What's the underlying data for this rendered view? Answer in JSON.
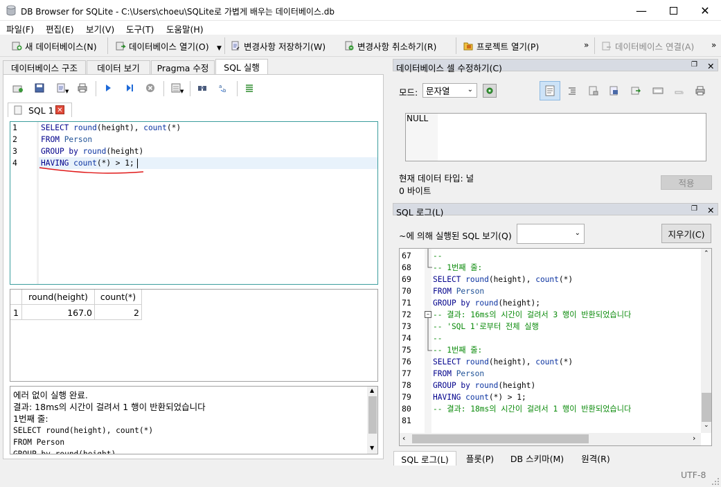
{
  "window": {
    "title": "DB Browser for SQLite - C:\\Users\\choeu\\SQLite로 가볍게 배우는 데이터베이스.db"
  },
  "menu": [
    "파일(F)",
    "편집(E)",
    "보기(V)",
    "도구(T)",
    "도움말(H)"
  ],
  "toolbar": {
    "new_db": "새 데이터베이스(N)",
    "open_db": "데이터베이스 열기(O)",
    "write_changes": "변경사항 저장하기(W)",
    "revert_changes": "변경사항 취소하기(R)",
    "open_project": "프로젝트 열기(P)",
    "attach_db": "데이터베이스 연결(A)"
  },
  "tabs": [
    "데이터베이스 구조",
    "데이터 보기",
    "Pragma 수정",
    "SQL 실행"
  ],
  "sql_tab": {
    "name": "SQL 1"
  },
  "editor": {
    "lines": [
      {
        "n": "1",
        "tokens": [
          [
            "kw",
            "SELECT "
          ],
          [
            "fn",
            "round"
          ],
          [
            "",
            "(height), "
          ],
          [
            "fn",
            "count"
          ],
          [
            "",
            "(*)"
          ]
        ]
      },
      {
        "n": "2",
        "tokens": [
          [
            "kw",
            "FROM "
          ],
          [
            "idn",
            "Person"
          ]
        ]
      },
      {
        "n": "3",
        "tokens": [
          [
            "kw",
            "GROUP by "
          ],
          [
            "fn",
            "round"
          ],
          [
            "",
            "(height)"
          ]
        ]
      },
      {
        "n": "4",
        "tokens": [
          [
            "kw",
            "HAVING "
          ],
          [
            "fn",
            "count"
          ],
          [
            "",
            "(*) > 1;"
          ]
        ]
      }
    ]
  },
  "results": {
    "columns": [
      "round(height)",
      "count(*)"
    ],
    "rows": [
      [
        "1",
        "167.0",
        "2"
      ]
    ]
  },
  "message": {
    "lines": [
      "에러 없이 실행 완료.",
      "결과: 18ms의 시간이 걸려서 1 행이 반환되었습니다",
      "1번째 줄:",
      "SELECT round(height), count(*)",
      "FROM Person",
      "GROUP by round(height)"
    ]
  },
  "cell_editor": {
    "title": "데이터베이스 셀 수정하기(C)",
    "mode_label": "모드:",
    "mode_value": "문자열",
    "value": "NULL",
    "type_label": "현재 데이터 타입: 널",
    "size_label": "0 바이트",
    "apply": "적용"
  },
  "sql_log": {
    "title": "SQL 로그(L)",
    "filter_label": "~에 의해 실행된 SQL 보기(Q)",
    "clear": "지우기(C)",
    "lines": [
      {
        "n": "67",
        "cls": "cm",
        "text": "--"
      },
      {
        "n": "68",
        "cls": "cm",
        "text": "-- 1번째 줄:"
      },
      {
        "n": "69",
        "cls": "",
        "tokens": [
          [
            "kw",
            "SELECT "
          ],
          [
            "fn",
            "round"
          ],
          [
            "",
            "(height), "
          ],
          [
            "fn",
            "count"
          ],
          [
            "",
            "(*)"
          ]
        ]
      },
      {
        "n": "70",
        "cls": "",
        "tokens": [
          [
            "kw",
            "FROM "
          ],
          [
            "idn",
            "Person"
          ]
        ]
      },
      {
        "n": "71",
        "cls": "",
        "tokens": [
          [
            "kw",
            "GROUP by "
          ],
          [
            "fn",
            "round"
          ],
          [
            "",
            "(height);"
          ]
        ]
      },
      {
        "n": "72",
        "cls": "cm",
        "text": "-- 결과: 16ms의 시간이 걸려서 3 행이 반환되었습니다"
      },
      {
        "n": "73",
        "cls": "cm",
        "text": "-- 'SQL 1'로부터 전체 실행"
      },
      {
        "n": "74",
        "cls": "cm",
        "text": "--"
      },
      {
        "n": "75",
        "cls": "cm",
        "text": "-- 1번째 줄:"
      },
      {
        "n": "76",
        "cls": "",
        "tokens": [
          [
            "kw",
            "SELECT "
          ],
          [
            "fn",
            "round"
          ],
          [
            "",
            "(height), "
          ],
          [
            "fn",
            "count"
          ],
          [
            "",
            "(*)"
          ]
        ]
      },
      {
        "n": "77",
        "cls": "",
        "tokens": [
          [
            "kw",
            "FROM "
          ],
          [
            "idn",
            "Person"
          ]
        ]
      },
      {
        "n": "78",
        "cls": "",
        "tokens": [
          [
            "kw",
            "GROUP by "
          ],
          [
            "fn",
            "round"
          ],
          [
            "",
            "(height)"
          ]
        ]
      },
      {
        "n": "79",
        "cls": "",
        "tokens": [
          [
            "kw",
            "HAVING "
          ],
          [
            "fn",
            "count"
          ],
          [
            "",
            "(*) > 1;"
          ]
        ]
      },
      {
        "n": "80",
        "cls": "cm",
        "text": "-- 결과: 18ms의 시간이 걸려서 1 행이 반환되었습니다"
      },
      {
        "n": "81",
        "cls": "",
        "text": ""
      }
    ]
  },
  "bottom_tabs": [
    "SQL 로그(L)",
    "플롯(P)",
    "DB 스키마(M)",
    "원격(R)"
  ],
  "status": {
    "encoding": "UTF-8"
  }
}
